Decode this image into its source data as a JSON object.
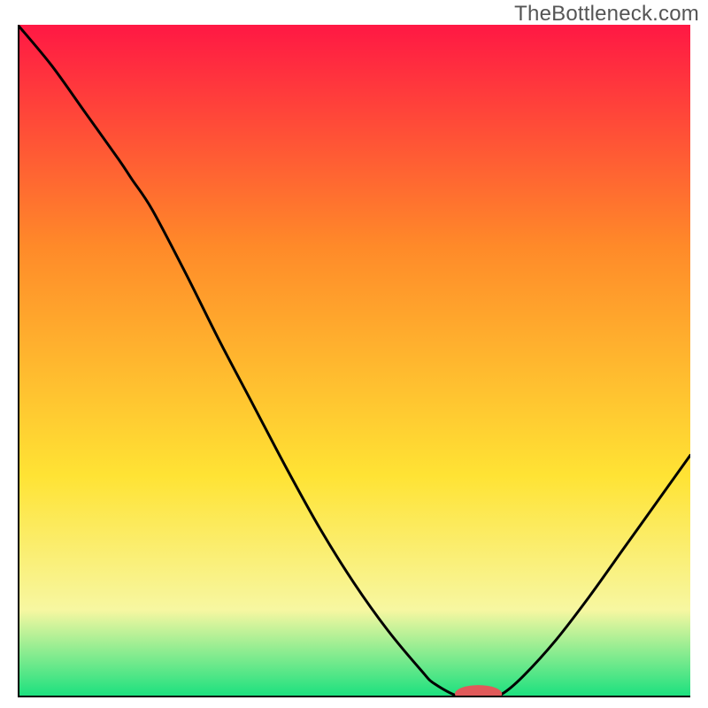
{
  "watermark": "TheBottleneck.com",
  "colors": {
    "top": "#ff1844",
    "mid_orange": "#ff8a29",
    "mid_yellow": "#ffe334",
    "pale_yellow": "#f7f7a1",
    "green": "#18e07e",
    "curve": "#000000",
    "marker": "#e05a5a",
    "axis": "#000000"
  },
  "chart_data": {
    "type": "line",
    "title": "",
    "xlabel": "",
    "ylabel": "",
    "xlim": [
      0,
      100
    ],
    "ylim": [
      0,
      100
    ],
    "legend": false,
    "series": [
      {
        "name": "bottleneck-curve",
        "x": [
          0,
          5,
          10,
          15,
          17,
          20,
          25,
          30,
          35,
          40,
          45,
          50,
          55,
          60,
          62,
          66,
          70,
          72,
          75,
          80,
          85,
          90,
          95,
          100
        ],
        "y": [
          100,
          94,
          87,
          80,
          77,
          72.5,
          63,
          53,
          43.5,
          34,
          25,
          17,
          10,
          4,
          2,
          0,
          0,
          0.5,
          3,
          8.5,
          15,
          22,
          29,
          36
        ]
      }
    ],
    "marker": {
      "x_center": 68.5,
      "y_center": 0,
      "rx": 3.5,
      "ry": 1.3
    },
    "gradient_stops": [
      {
        "offset": 0,
        "color": "#ff1844"
      },
      {
        "offset": 33,
        "color": "#ff8a29"
      },
      {
        "offset": 67,
        "color": "#ffe334"
      },
      {
        "offset": 87,
        "color": "#f7f7a1"
      },
      {
        "offset": 100,
        "color": "#18e07e"
      }
    ]
  }
}
